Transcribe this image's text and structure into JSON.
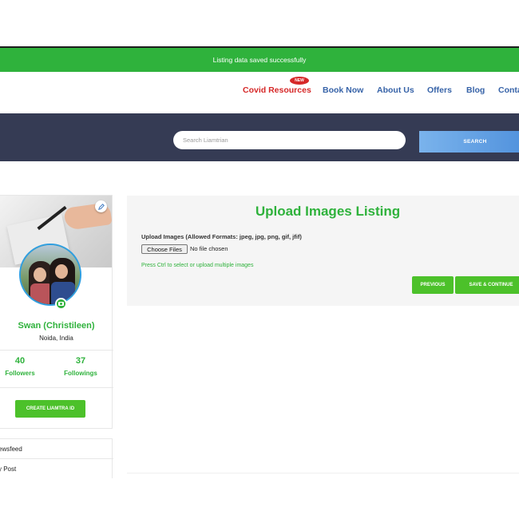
{
  "status": {
    "message": "Listing data saved successfully"
  },
  "nav": {
    "badge_new": "NEW",
    "items": [
      {
        "label": "Covid Resources"
      },
      {
        "label": "Book Now"
      },
      {
        "label": "About Us"
      },
      {
        "label": "Offers"
      },
      {
        "label": "Blog"
      },
      {
        "label": "Conta"
      }
    ]
  },
  "search": {
    "placeholder": "Search Liamtrian",
    "button_label": "SEARCH"
  },
  "profile": {
    "name": "Swan (Christileen)",
    "location": "Noida, India",
    "followers_count": "40",
    "followers_label": "Followers",
    "followings_count": "37",
    "followings_label": "Followings",
    "create_button": "CREATE LIAMTRA ID"
  },
  "menu": {
    "items": [
      {
        "label": "ewsfeed"
      },
      {
        "label": "y Post"
      }
    ]
  },
  "upload": {
    "title": "Upload Images Listing",
    "field_label": "Upload Images (Allowed Formats: jpeg, jpg, png, gif, jfif)",
    "choose_button": "Choose Files",
    "file_status": "No file chosen",
    "hint": "Press Ctrl to select or upload multiple images",
    "previous_button": "PREVIOUS",
    "save_button": "SAVE & CONTINUE"
  },
  "colors": {
    "green_accent": "#2fb23c",
    "button_green": "#4cc12a",
    "nav_blue": "#3763a8",
    "covid_red": "#d62828",
    "search_band": "#353b54"
  },
  "icons": {
    "edit": "pencil-edit-icon",
    "camera": "camera-icon"
  }
}
